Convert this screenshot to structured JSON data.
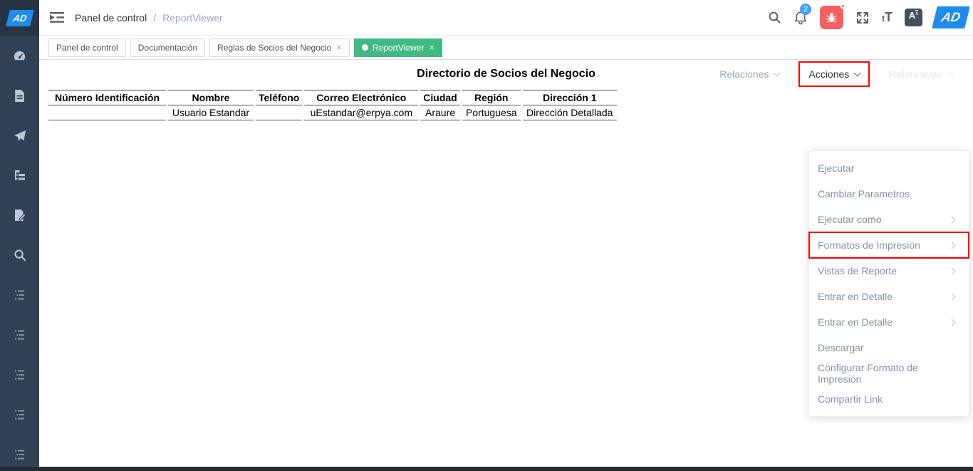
{
  "colors": {
    "accent_green": "#42b983",
    "alert_red": "#f56060",
    "badge_blue": "#409eff",
    "highlight_red": "#ff0000",
    "logo_blue": "#1f8ceb",
    "sidebar_bg": "#304156"
  },
  "sidebar": {
    "logo_text": "AD",
    "icons": [
      "dashboard-icon",
      "document-icon",
      "send-icon",
      "tree-list-icon",
      "document-edit-icon",
      "search-icon",
      "nested-list-icon",
      "nested-list-icon",
      "nested-list-icon",
      "nested-list-icon",
      "nested-list-icon"
    ]
  },
  "topbar": {
    "breadcrumb": {
      "items": [
        "Panel de control",
        "ReportViewer"
      ],
      "separator": "/"
    },
    "notification_count": "2",
    "font_size_small": "t",
    "font_size_large": "T",
    "language_label": "A",
    "language_sup": "x",
    "logo_text": "AD"
  },
  "tabs": [
    {
      "label": "Panel de control",
      "active": false,
      "closable": false
    },
    {
      "label": "Documentación",
      "active": false,
      "closable": false
    },
    {
      "label": "Reglas de Socios del Negocio",
      "active": false,
      "closable": true
    },
    {
      "label": "ReportViewer",
      "active": true,
      "closable": true
    }
  ],
  "actions_bar": {
    "buttons": [
      {
        "label": "Relaciones",
        "state": "normal",
        "highlighted": false
      },
      {
        "label": "Acciones",
        "state": "active",
        "highlighted": true
      },
      {
        "label": "Referencias",
        "state": "disabled",
        "highlighted": false
      }
    ]
  },
  "report": {
    "title": "Directorio de Socios del Negocio",
    "columns": [
      "Número Identificación",
      "Nombre",
      "Teléfono",
      "Correo Electrónico",
      "Ciudad",
      "Región",
      "Dirección 1"
    ],
    "rows": [
      [
        "",
        "Usuario Estandar",
        "",
        "uEstandar@erpya.com",
        "Araure",
        "Portuguesa",
        "Dirección Detallada"
      ]
    ]
  },
  "actions_menu": {
    "items": [
      {
        "label": "Ejecutar",
        "submenu": false,
        "highlighted": false
      },
      {
        "label": "Cambiar Parametros",
        "submenu": false,
        "highlighted": false
      },
      {
        "label": "Ejecutar como",
        "submenu": true,
        "highlighted": false
      },
      {
        "label": "Formatos de Impresión",
        "submenu": true,
        "highlighted": true
      },
      {
        "label": "Vistas de Reporte",
        "submenu": true,
        "highlighted": false
      },
      {
        "label": "Entrar en Detalle",
        "submenu": true,
        "highlighted": false
      },
      {
        "label": "Entrar en Detalle",
        "submenu": true,
        "highlighted": false
      },
      {
        "label": "Descargar",
        "submenu": false,
        "highlighted": false
      },
      {
        "label": "Configurar Formato de Impresión",
        "submenu": false,
        "highlighted": false
      },
      {
        "label": "Compartir Link",
        "submenu": false,
        "highlighted": false
      }
    ]
  }
}
